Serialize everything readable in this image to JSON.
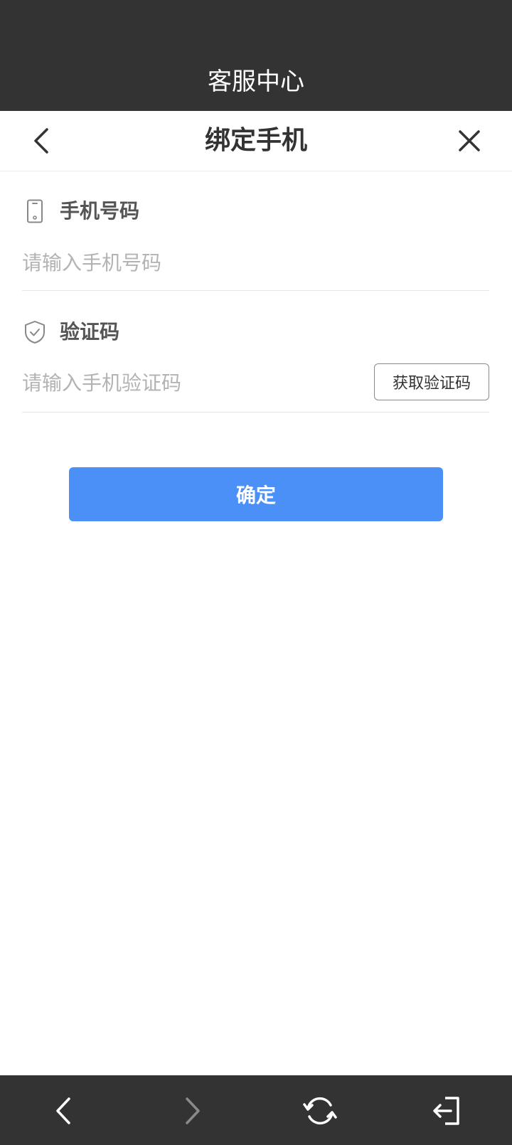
{
  "top_bar": {
    "title": "客服中心"
  },
  "nav": {
    "title": "绑定手机",
    "back_icon": "chevron-left-icon",
    "close_icon": "close-icon"
  },
  "form": {
    "phone": {
      "label": "手机号码",
      "icon": "phone-icon",
      "placeholder": "请输入手机号码",
      "value": ""
    },
    "code": {
      "label": "验证码",
      "icon": "shield-check-icon",
      "placeholder": "请输入手机验证码",
      "value": "",
      "get_code_label": "获取验证码"
    },
    "confirm_label": "确定"
  },
  "bottom_bar": {
    "items": [
      {
        "icon": "back-arrow-icon",
        "enabled": true
      },
      {
        "icon": "forward-arrow-icon",
        "enabled": false
      },
      {
        "icon": "refresh-icon",
        "enabled": true
      },
      {
        "icon": "exit-icon",
        "enabled": true
      }
    ]
  },
  "colors": {
    "bar_background": "#333333",
    "accent": "#4a90f7",
    "placeholder": "#b3b3b3"
  }
}
